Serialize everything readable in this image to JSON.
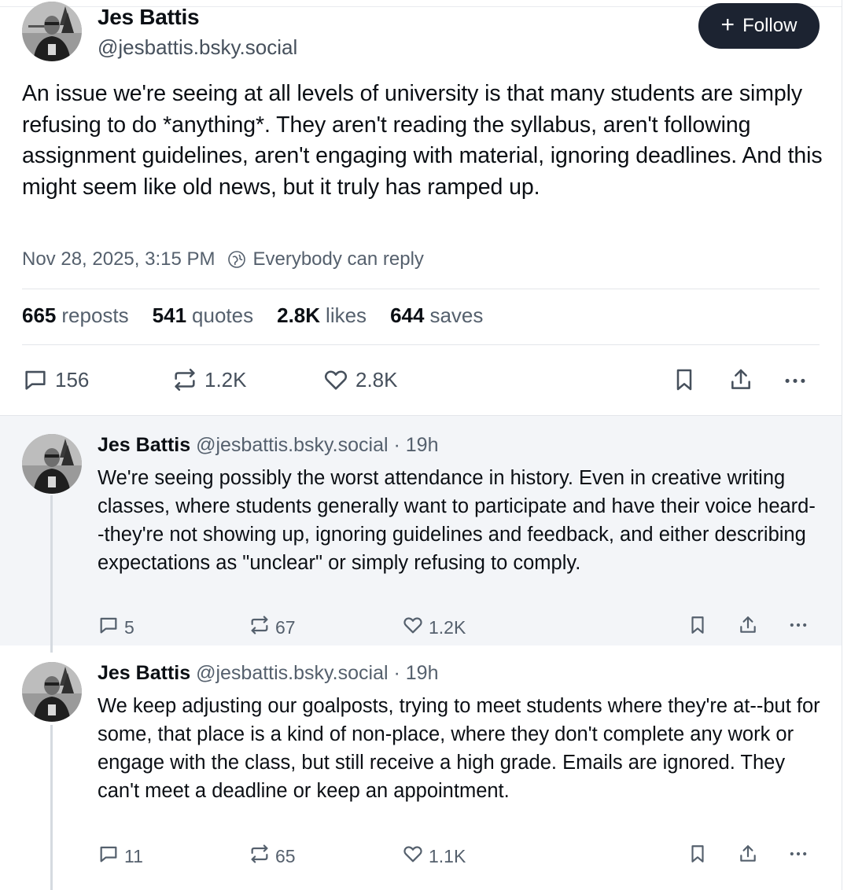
{
  "main_post": {
    "author_name": "Jes Battis",
    "handle": "@jesbattis.bsky.social",
    "follow_label": "Follow",
    "text": "An issue we're seeing at all levels of university is that many students are simply refusing to do *anything*. They aren't reading the syllabus, aren't following assignment guidelines, aren't engaging with material, ignoring deadlines. And this might seem like old news, but it truly has ramped up.",
    "timestamp": "Nov 28, 2025, 3:15 PM",
    "reply_setting": "Everybody can reply",
    "stats": {
      "reposts_count": "665",
      "reposts_label": "reposts",
      "quotes_count": "541",
      "quotes_label": "quotes",
      "likes_count": "2.8K",
      "likes_label": "likes",
      "saves_count": "644",
      "saves_label": "saves"
    },
    "actions": {
      "replies": "156",
      "reposts": "1.2K",
      "likes": "2.8K"
    }
  },
  "replies": [
    {
      "author_name": "Jes Battis",
      "handle": "@jesbattis.bsky.social",
      "time": "· 19h",
      "text": "We're seeing possibly the worst attendance in history. Even in creative writing classes, where students generally want to participate and have their voice heard--they're not showing up, ignoring guidelines and feedback, and either describing expectations as \"unclear\" or simply refusing to comply.",
      "replies": "5",
      "reposts": "67",
      "likes": "1.2K"
    },
    {
      "author_name": "Jes Battis",
      "handle": "@jesbattis.bsky.social",
      "time": "· 19h",
      "text": "We keep adjusting our goalposts, trying to meet students where they're at--but for some, that place is a kind of non-place, where they don't complete any work or engage with the class, but still receive a high grade. Emails are ignored. They can't meet a deadline or keep an appointment.",
      "replies": "11",
      "reposts": "65",
      "likes": "1.1K"
    }
  ],
  "icons": {
    "reply": "speech-bubble-icon",
    "repost": "repost-arrows-icon",
    "like": "heart-icon",
    "bookmark": "bookmark-icon",
    "share": "share-upload-icon",
    "more": "ellipsis-icon",
    "reply_setting": "globe-icon"
  },
  "colors": {
    "follow_bg": "#1c2331",
    "muted_text": "#55606d",
    "reply_bg": "#f3f5f8"
  }
}
